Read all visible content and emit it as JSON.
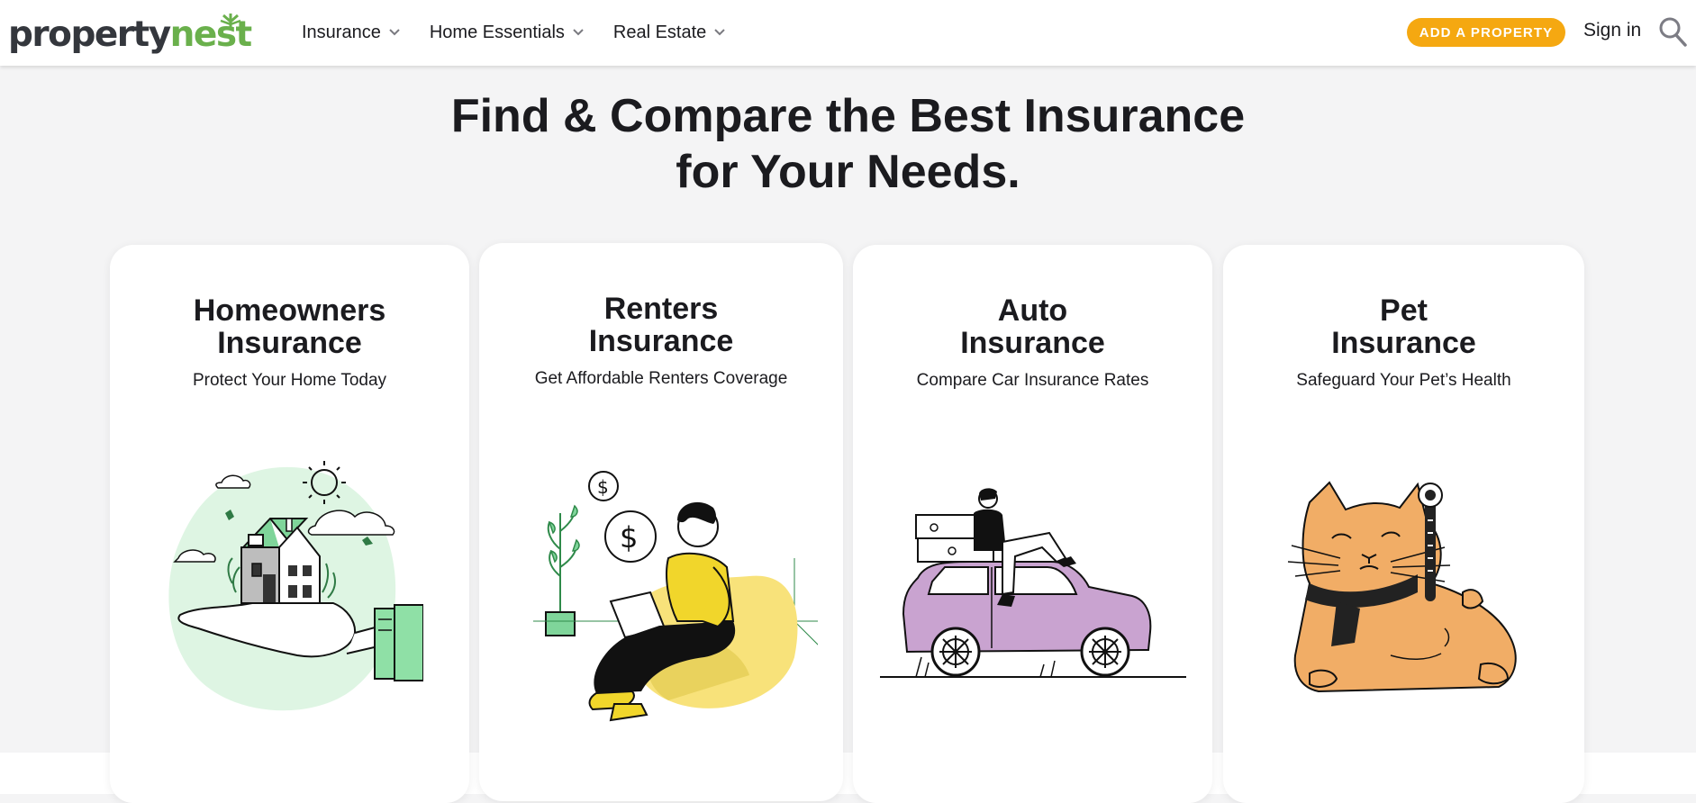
{
  "header": {
    "logo": {
      "part1": "property",
      "part2": "nest"
    },
    "nav": [
      {
        "label": "Insurance"
      },
      {
        "label": "Home Essentials"
      },
      {
        "label": "Real Estate"
      }
    ],
    "cta_label": "ADD A PROPERTY",
    "signin_label": "Sign in",
    "search_icon": "search-icon"
  },
  "hero": {
    "title_line1": "Find & Compare the Best Insurance",
    "title_line2": "for Your Needs."
  },
  "cards": [
    {
      "title_line1": "Homeowners",
      "title_line2": "Insurance",
      "subtitle": "Protect Your Home Today",
      "icon": "house-in-hand-illustration"
    },
    {
      "title_line1": "Renters",
      "title_line2": "Insurance",
      "subtitle": "Get Affordable Renters Coverage",
      "icon": "person-with-laptop-illustration"
    },
    {
      "title_line1": "Auto",
      "title_line2": "Insurance",
      "subtitle": "Compare Car Insurance Rates",
      "icon": "woman-on-car-illustration"
    },
    {
      "title_line1": "Pet",
      "title_line2": "Insurance",
      "subtitle": "Safeguard Your Pet’s Health",
      "icon": "cat-with-thermometer-illustration"
    }
  ],
  "colors": {
    "brand_green": "#6ab04c",
    "cta_orange": "#f5a811",
    "background": "#f4f4f5"
  }
}
